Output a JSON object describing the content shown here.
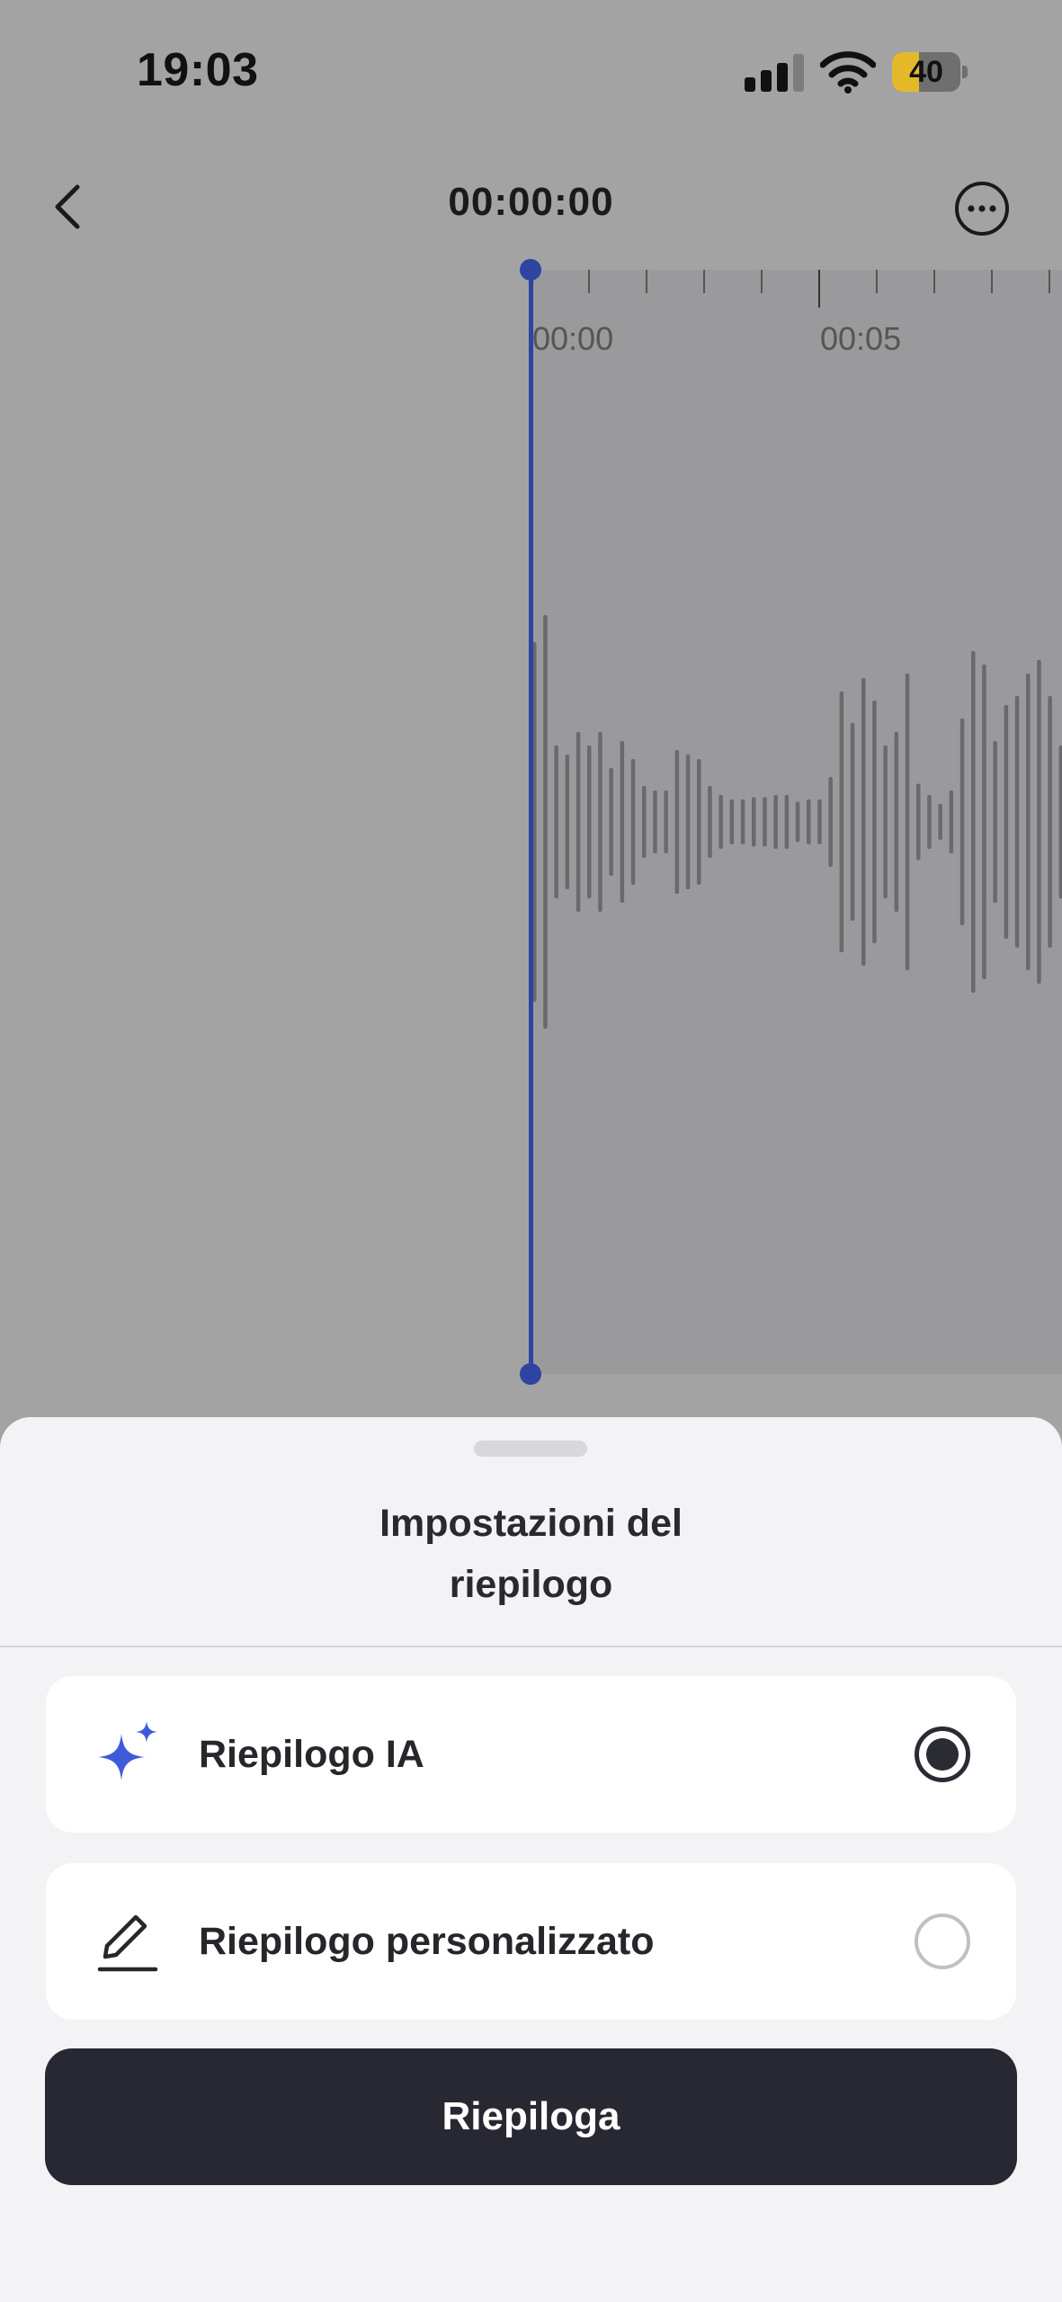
{
  "status_bar": {
    "time": "19:03",
    "battery_percent": "40",
    "battery_level": 0.4,
    "signal_bars_active": 3,
    "signal_bars_total": 4
  },
  "recorder": {
    "elapsed_time": "00:00:00",
    "timeline_labels": [
      "00:00",
      "00:05"
    ],
    "playhead_color": "#2f43a0"
  },
  "sheet": {
    "title_line1": "Impostazioni del",
    "title_line2": "riepilogo",
    "options": [
      {
        "label": "Riepilogo IA",
        "icon": "sparkle-icon",
        "selected": true
      },
      {
        "label": "Riepilogo personalizzato",
        "icon": "pencil-icon",
        "selected": false
      }
    ],
    "primary_button": "Riepiloga",
    "accent_color": "#3d5bd9",
    "button_color": "#272831"
  }
}
